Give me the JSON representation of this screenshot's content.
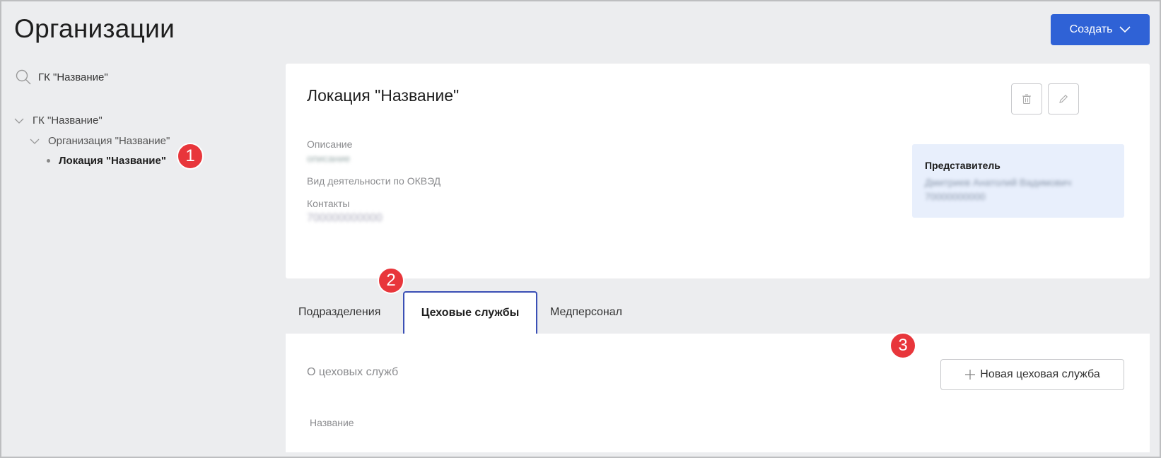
{
  "page": {
    "title": "Организации"
  },
  "header": {
    "create_label": "Создать"
  },
  "sidebar": {
    "search_value": "ГК \"Название\"",
    "tree": [
      {
        "label": "ГК \"Название\""
      },
      {
        "label": "Организация \"Название\""
      },
      {
        "label": "Локация \"Название\""
      }
    ]
  },
  "badges": [
    "1",
    "2",
    "3"
  ],
  "card": {
    "title": "Локация \"Название\"",
    "description_label": "Описание",
    "description_value": "описание",
    "activity_label": "Вид деятельности по ОКВЭД",
    "contacts_label": "Контакты",
    "contacts_value": "700000000000",
    "representative": {
      "title": "Представитель",
      "name": "Дмитриев Анатолий Вадимович",
      "phone": "70000000000"
    }
  },
  "tabs": [
    {
      "label": "Подразделения"
    },
    {
      "label": "Цеховые службы",
      "active": true
    },
    {
      "label": "Медперсонал"
    }
  ],
  "section": {
    "note": "О цеховых служб",
    "new_button_label": "Новая цеховая служба",
    "columns": [
      "Название"
    ]
  },
  "colors": {
    "accent": "#2f62d6",
    "badge": "#e8363b",
    "active_tab_border": "#3a4fb5",
    "rep_bg": "#e8effc"
  }
}
